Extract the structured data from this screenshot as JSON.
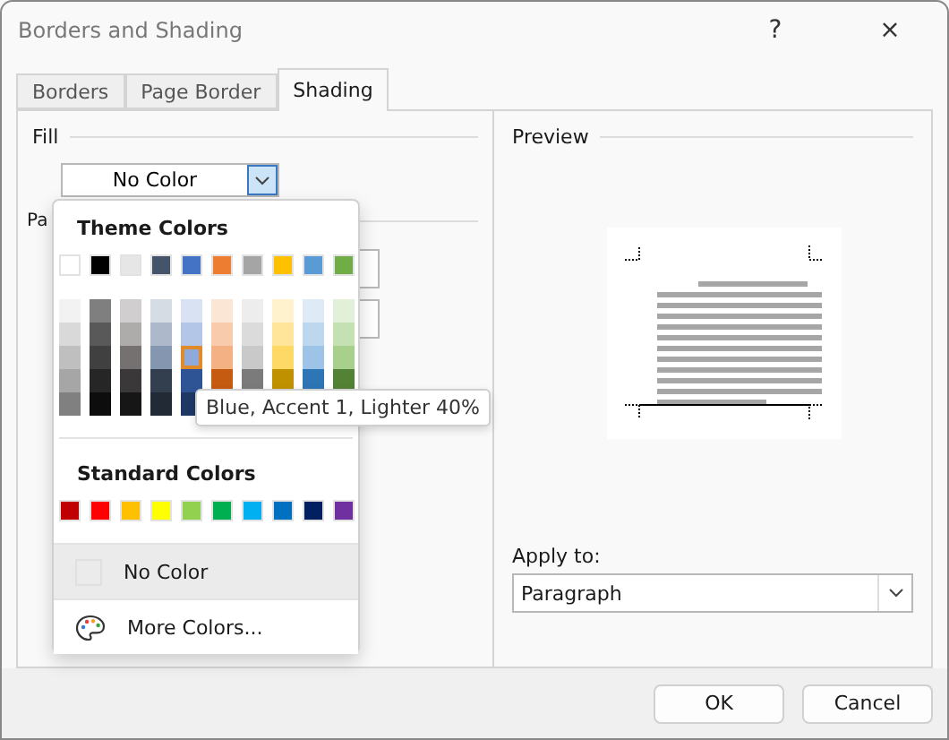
{
  "window": {
    "title": "Borders and Shading",
    "help": "?",
    "close": "×"
  },
  "tabs": [
    {
      "label": "Borders",
      "selected": false
    },
    {
      "label": "Page Border",
      "selected": false
    },
    {
      "label": "Shading",
      "selected": true
    }
  ],
  "fill": {
    "label": "Fill",
    "value": "No Color",
    "open": true
  },
  "patterns": {
    "label": "Pa"
  },
  "color_menu": {
    "theme_title": "Theme Colors",
    "theme_colors": [
      {
        "color": "#ffffff",
        "selected": false,
        "shades": [
          {
            "color": "#f2f2f2",
            "selected": false
          },
          {
            "color": "#d9d9d9",
            "selected": false
          },
          {
            "color": "#bfbfbf",
            "selected": false
          },
          {
            "color": "#a6a6a6",
            "selected": false
          },
          {
            "color": "#808080",
            "selected": false
          }
        ]
      },
      {
        "color": "#000000",
        "selected": false,
        "shades": [
          {
            "color": "#7f7f7f",
            "selected": false
          },
          {
            "color": "#595959",
            "selected": false
          },
          {
            "color": "#404040",
            "selected": false
          },
          {
            "color": "#262626",
            "selected": false
          },
          {
            "color": "#0d0d0d",
            "selected": false
          }
        ]
      },
      {
        "color": "#e7e6e6",
        "selected": false,
        "shades": [
          {
            "color": "#d0cece",
            "selected": false
          },
          {
            "color": "#aeabab",
            "selected": false
          },
          {
            "color": "#757171",
            "selected": false
          },
          {
            "color": "#3a3838",
            "selected": false
          },
          {
            "color": "#171616",
            "selected": false
          }
        ]
      },
      {
        "color": "#44546a",
        "selected": false,
        "shades": [
          {
            "color": "#d6dce4",
            "selected": false
          },
          {
            "color": "#adb9ca",
            "selected": false
          },
          {
            "color": "#8496b0",
            "selected": false
          },
          {
            "color": "#333f4f",
            "selected": false
          },
          {
            "color": "#222a35",
            "selected": false
          }
        ]
      },
      {
        "color": "#4472c4",
        "selected": false,
        "shades": [
          {
            "color": "#d9e2f3",
            "selected": false
          },
          {
            "color": "#b4c6e7",
            "selected": false
          },
          {
            "color": "#8eaadb",
            "selected": true
          },
          {
            "color": "#2f5496",
            "selected": false
          },
          {
            "color": "#1f3864",
            "selected": false
          }
        ]
      },
      {
        "color": "#ed7d31",
        "selected": false,
        "shades": [
          {
            "color": "#fbe5d5",
            "selected": false
          },
          {
            "color": "#f7cbac",
            "selected": false
          },
          {
            "color": "#f4b183",
            "selected": false
          },
          {
            "color": "#c55a11",
            "selected": false
          }
        ]
      },
      {
        "color": "#a5a5a5",
        "selected": false,
        "shades": [
          {
            "color": "#ededed",
            "selected": false
          },
          {
            "color": "#dbdbdb",
            "selected": false
          },
          {
            "color": "#c9c9c9",
            "selected": false
          },
          {
            "color": "#7b7b7b",
            "selected": false
          }
        ]
      },
      {
        "color": "#ffc000",
        "selected": false,
        "shades": [
          {
            "color": "#fff2cc",
            "selected": false
          },
          {
            "color": "#fee599",
            "selected": false
          },
          {
            "color": "#ffd965",
            "selected": false
          },
          {
            "color": "#bf9000",
            "selected": false
          }
        ]
      },
      {
        "color": "#5b9bd5",
        "selected": false,
        "shades": [
          {
            "color": "#deebf6",
            "selected": false
          },
          {
            "color": "#bdd7ee",
            "selected": false
          },
          {
            "color": "#9dc3e6",
            "selected": false
          },
          {
            "color": "#2e75b5",
            "selected": false
          }
        ]
      },
      {
        "color": "#70ad47",
        "selected": false,
        "shades": [
          {
            "color": "#e2efd9",
            "selected": false
          },
          {
            "color": "#c5e0b3",
            "selected": false
          },
          {
            "color": "#a8d08d",
            "selected": false
          },
          {
            "color": "#538135",
            "selected": false
          }
        ]
      }
    ],
    "tooltip": "Blue, Accent 1, Lighter 40%",
    "standard_title": "Standard Colors",
    "standard_colors": [
      {
        "color": "#c00000",
        "selected": false
      },
      {
        "color": "#ff0000",
        "selected": false
      },
      {
        "color": "#ffc000",
        "selected": false
      },
      {
        "color": "#ffff00",
        "selected": false
      },
      {
        "color": "#92d050",
        "selected": false
      },
      {
        "color": "#00b050",
        "selected": false
      },
      {
        "color": "#00b0f0",
        "selected": false
      },
      {
        "color": "#0070c0",
        "selected": false
      },
      {
        "color": "#002060",
        "selected": false
      },
      {
        "color": "#7030a0",
        "selected": false
      }
    ],
    "items": [
      {
        "kind": "no-color",
        "label": "No Color",
        "highlighted": true
      },
      {
        "kind": "more",
        "label": "More Colors...",
        "highlighted": false
      }
    ]
  },
  "preview": {
    "label": "Preview"
  },
  "apply_to": {
    "label": "Apply to:",
    "value": "Paragraph"
  },
  "buttons": [
    {
      "label": "OK"
    },
    {
      "label": "Cancel"
    }
  ]
}
